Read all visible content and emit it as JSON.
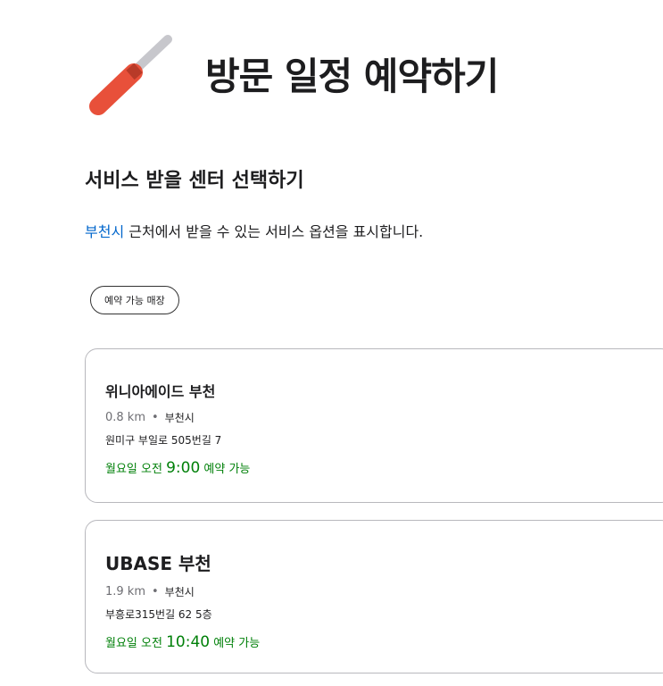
{
  "header": {
    "title": "방문 일정 예약하기",
    "icon": "screwdriver-icon"
  },
  "section": {
    "title": "서비스 받을 센터 선택하기",
    "subtitle_city": "부천시",
    "subtitle_rest": " 근처에서 받을 수 있는 서비스 옵션을 표시합니다."
  },
  "filter": {
    "label": "예약 가능 매장"
  },
  "stores": [
    {
      "name": "위니아에이드 부천",
      "distance": "0.8 km",
      "separator": "•",
      "city": "부천시",
      "address": "원미구 부일로 505번길 7",
      "availability_prefix": "월요일 오전 ",
      "availability_time": "9:00",
      "availability_suffix": " 예약 가능"
    },
    {
      "name": "UBASE 부천",
      "distance": "1.9 km",
      "separator": "•",
      "city": "부천시",
      "address": "부흥로315번길 62 5층",
      "availability_prefix": "월요일 오전 ",
      "availability_time": "10:40",
      "availability_suffix": " 예약 가능"
    }
  ],
  "colors": {
    "link": "#0066cc",
    "available": "#008009",
    "icon_handle": "#e8503a",
    "icon_shaft": "#c7c7cc"
  }
}
